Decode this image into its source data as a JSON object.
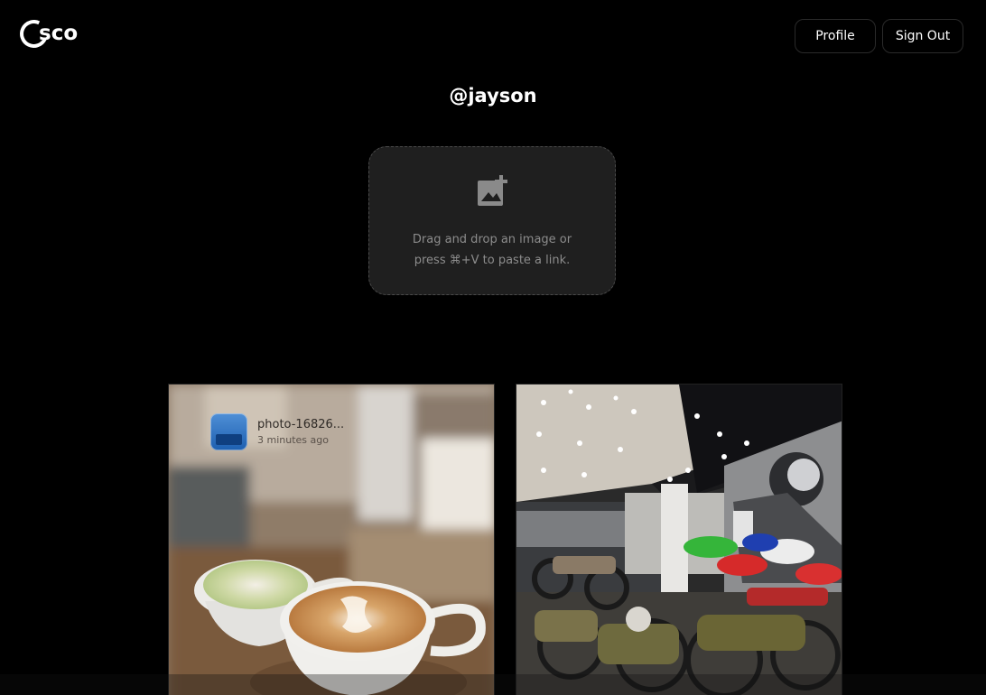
{
  "header": {
    "logo_text": "sco",
    "profile_label": "Profile",
    "signout_label": "Sign Out"
  },
  "user": {
    "handle": "@jayson"
  },
  "dropzone": {
    "line1": "Drag and drop an image or",
    "line2": "press ⌘+V to paste a link.",
    "icon": "add-photo-icon"
  },
  "gallery": {
    "items": [
      {
        "name": "photo-16826...",
        "time": "3 minutes ago",
        "subject": "two latte cups on a wooden table"
      },
      {
        "name": "",
        "time": "",
        "subject": "motorcycle museum showroom"
      }
    ]
  },
  "colors": {
    "background": "#000000",
    "dropzone_bg": "#1f1f1f",
    "muted_text": "#8c8c8c"
  }
}
